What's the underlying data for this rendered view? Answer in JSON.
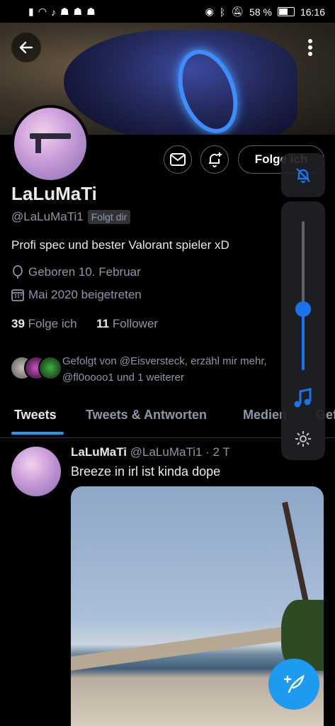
{
  "status_bar": {
    "battery": "58 %",
    "time": "16:16"
  },
  "header": {
    "back": "back",
    "more": "more-options"
  },
  "profile": {
    "name": "LaLuMaTi",
    "handle": "@LaLuMaTi1",
    "follows_you": "Folgt dir",
    "follow_button": "Folge ich",
    "bio": "Profi spec und bester Valorant spieler xD",
    "birthday": "Geboren 10. Februar",
    "joined": "Mai 2020 beigetreten",
    "following_count": "39",
    "following_label": "Folge ich",
    "followers_count": "11",
    "followers_label": "Follower",
    "followed_by_line1": "Gefolgt von @Eisversteck, erzähl mir mehr,",
    "followed_by_line2": "@fl0oooo1 und 1 weiterer"
  },
  "tabs": [
    {
      "label": "Tweets",
      "active": true
    },
    {
      "label": "Tweets & Antworten",
      "active": false
    },
    {
      "label": "Medien",
      "active": false
    },
    {
      "label": "Gef",
      "active": false
    }
  ],
  "tweet": {
    "author": "LaLuMaTi",
    "handle_time": "@LaLuMaTi1 · 2 T",
    "text": "Breeze in irl ist kinda dope"
  },
  "volume_overlay": {
    "level": 0.41,
    "icons": [
      "bell-muted-icon",
      "music-note-icon",
      "gear-icon"
    ],
    "accent": "#1a73e8"
  },
  "colors": {
    "accent": "#1d9bf0",
    "secondary_text": "#8b98a5"
  }
}
